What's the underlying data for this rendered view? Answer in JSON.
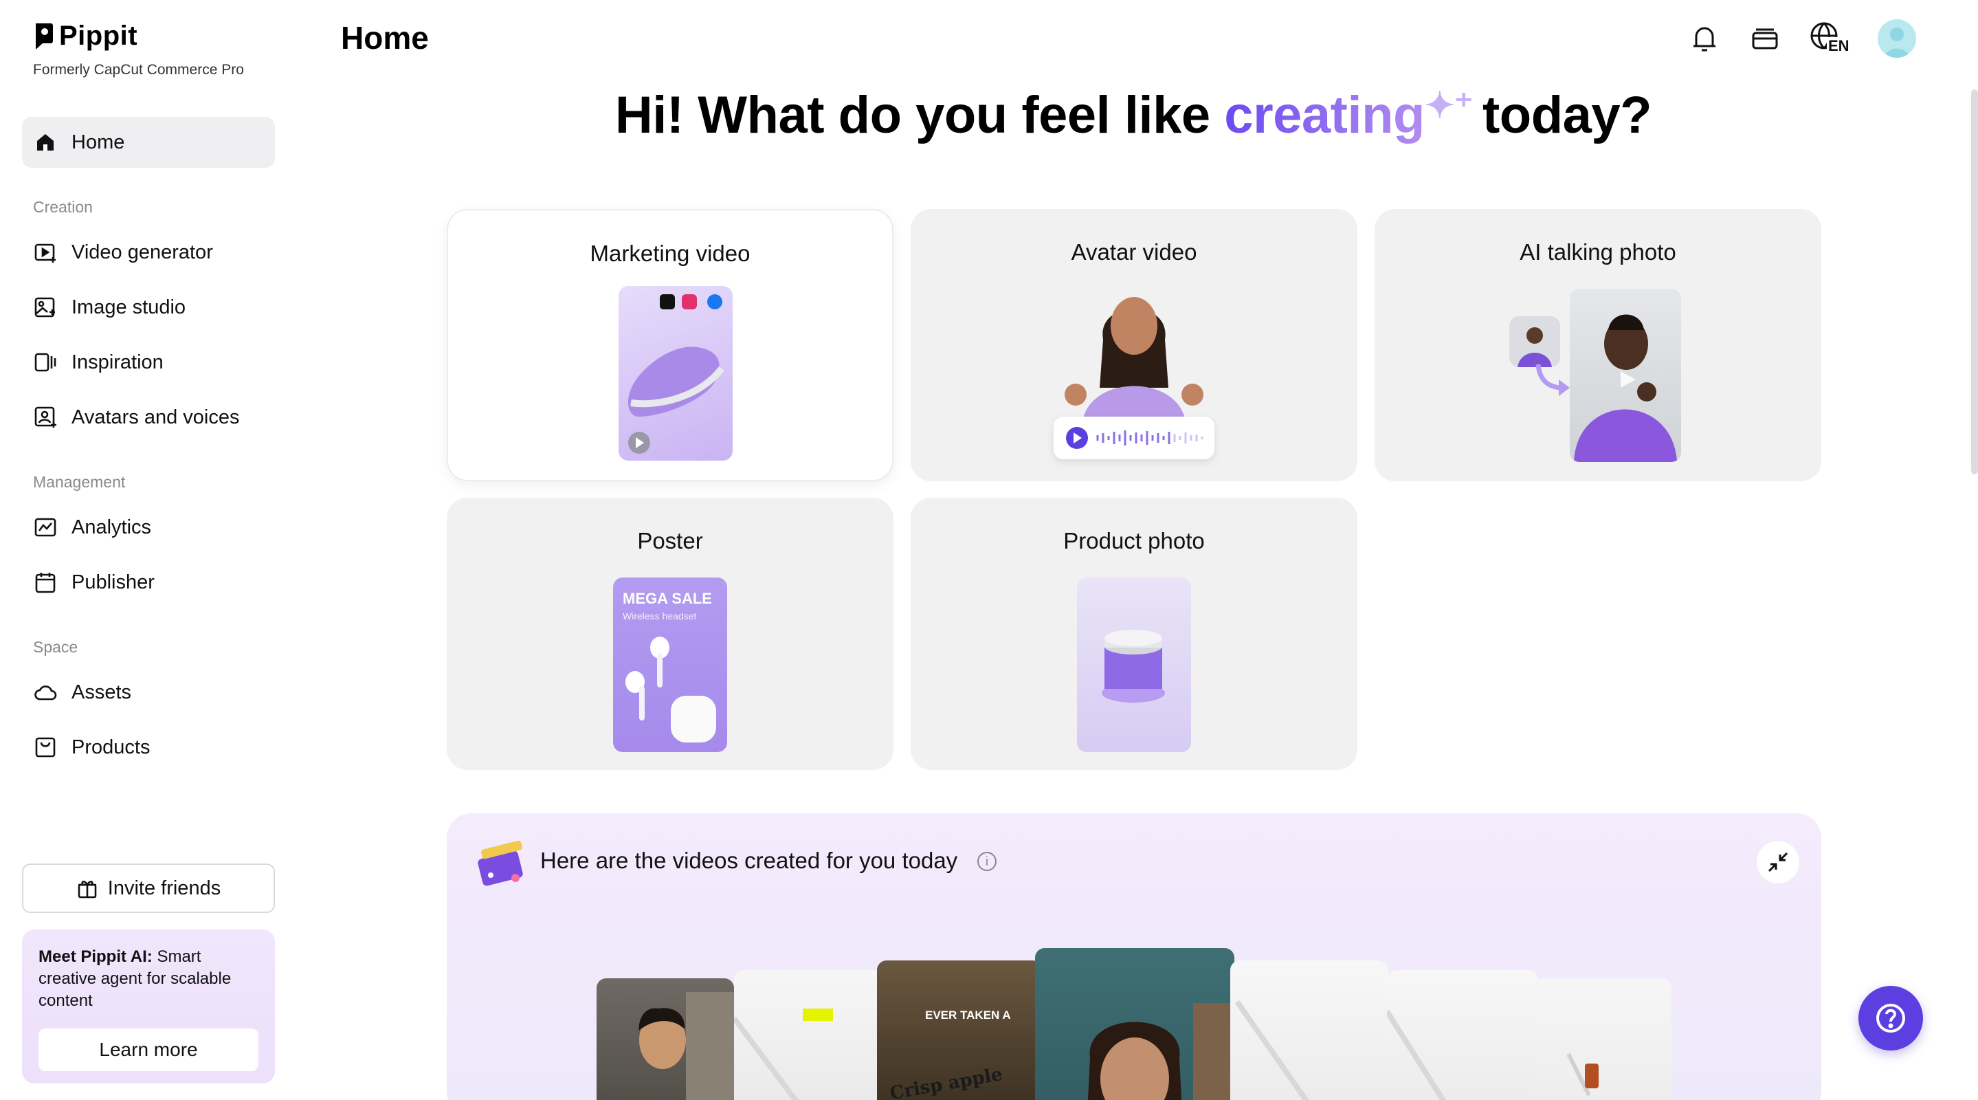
{
  "brand": {
    "name": "Pippit",
    "subtitle": "Formerly CapCut Commerce Pro"
  },
  "sidebar": {
    "home": "Home",
    "sections": {
      "creation": "Creation",
      "management": "Management",
      "space": "Space"
    },
    "creation_items": [
      {
        "label": "Video generator",
        "icon": "video-generator-icon"
      },
      {
        "label": "Image studio",
        "icon": "image-studio-icon"
      },
      {
        "label": "Inspiration",
        "icon": "inspiration-icon"
      },
      {
        "label": "Avatars and voices",
        "icon": "avatar-voice-icon"
      }
    ],
    "management_items": [
      {
        "label": "Analytics",
        "icon": "analytics-icon"
      },
      {
        "label": "Publisher",
        "icon": "calendar-icon"
      }
    ],
    "space_items": [
      {
        "label": "Assets",
        "icon": "cloud-icon"
      },
      {
        "label": "Products",
        "icon": "product-box-icon"
      }
    ],
    "invite": "Invite friends",
    "promo": {
      "bold": "Meet Pippit AI:",
      "text": " Smart creative agent for scalable content",
      "button": "Learn more"
    }
  },
  "header": {
    "title": "Home",
    "language": "EN"
  },
  "hero": {
    "before": "Hi! What do you feel like ",
    "accent": "creating",
    "after": "today?",
    "accent_colors": [
      "#6a4bf0",
      "#b38cf0"
    ]
  },
  "cards": [
    {
      "title": "Marketing video"
    },
    {
      "title": "Avatar video"
    },
    {
      "title": "AI talking photo"
    },
    {
      "title": "Poster",
      "poster_headline": "MEGA SALE",
      "poster_sub": "Wireless headset"
    },
    {
      "title": "Product photo"
    }
  ],
  "videos_panel": {
    "title": "Here are the videos created for you today",
    "thumb_caption_top": "EVER TAKEN A",
    "thumb_caption_bottom": "Crisp apple flavo"
  },
  "colors": {
    "accent": "#5b3fe0",
    "active_nav_bg": "#efeff1",
    "card_bg": "#f1f1f2"
  }
}
